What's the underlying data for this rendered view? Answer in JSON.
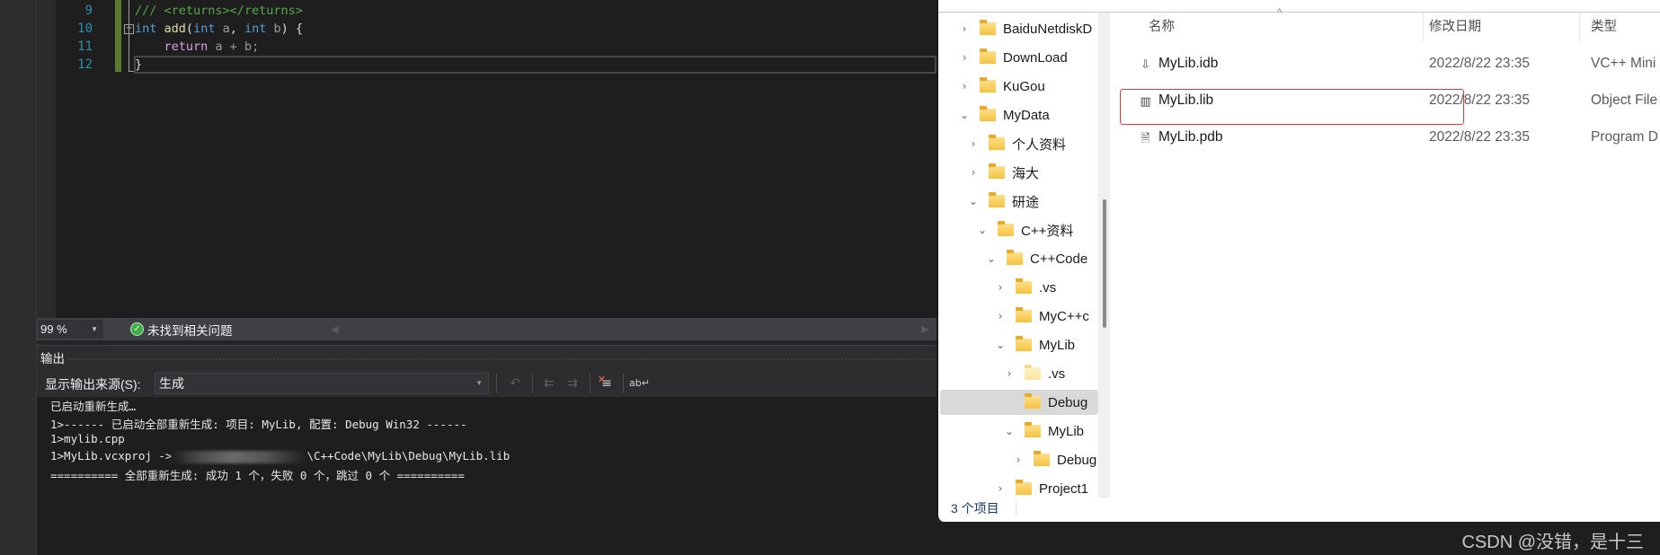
{
  "editor": {
    "line_numbers": [
      "9",
      "10",
      "11",
      "12"
    ],
    "lines": {
      "l9_comment": "/// <returns></returns>",
      "l10_kw1": "int",
      "l10_fn": "add",
      "l10_open": "(",
      "l10_kw2": "int",
      "l10_p1": " a",
      "l10_comma": ", ",
      "l10_kw3": "int",
      "l10_p2": " b",
      "l10_close": ") {",
      "l11_indent": "    ",
      "l11_kw": "return",
      "l11_expr": " a + b;",
      "l12": "}"
    },
    "fold_glyph": "−",
    "colors": {
      "keyword": "#569cd6",
      "function": "#dcdcaa",
      "comment": "#57a64a",
      "control": "#d8a0df",
      "line_number": "#2b91af"
    }
  },
  "status": {
    "zoom": "99 %",
    "issues_text": "未找到相关问题",
    "issues_icon": "check-circle-icon"
  },
  "output": {
    "title": "输出",
    "source_label": "显示输出来源(S):",
    "source_value": "生成",
    "toolbar": [
      "go-to-build-error-icon",
      "previous-message-icon",
      "next-message-icon",
      "clear-all-icon",
      "toggle-word-wrap-icon"
    ],
    "lines": [
      "已启动重新生成…",
      "1>------ 已启动全部重新生成: 项目: MyLib, 配置: Debug Win32 ------",
      "1>mylib.cpp",
      "1>MyLib.vcxproj ->",
      "\\C++Code\\MyLib\\Debug\\MyLib.lib",
      "========== 全部重新生成: 成功 1 个，失败 0 个，跳过 0 个 =========="
    ]
  },
  "explorer": {
    "tree": [
      {
        "label": "BaiduNetdiskD",
        "chevron": "›"
      },
      {
        "label": "DownLoad",
        "chevron": "›"
      },
      {
        "label": "KuGou",
        "chevron": "›"
      },
      {
        "label": "MyData",
        "chevron": "⌄"
      },
      {
        "label": "个人资料",
        "chevron": "›"
      },
      {
        "label": "海大",
        "chevron": "›"
      },
      {
        "label": "研途",
        "chevron": "⌄"
      },
      {
        "label": "C++资料",
        "chevron": "⌄"
      },
      {
        "label": "C++Code",
        "chevron": "⌄"
      },
      {
        "label": ".vs",
        "chevron": "›"
      },
      {
        "label": "MyC++c",
        "chevron": "›"
      },
      {
        "label": "MyLib",
        "chevron": "⌄"
      },
      {
        "label": ".vs",
        "chevron": "›"
      },
      {
        "label": "Debug",
        "chevron": ""
      },
      {
        "label": "MyLib",
        "chevron": "⌄"
      },
      {
        "label": "Debug",
        "chevron": "›"
      },
      {
        "label": "Project1",
        "chevron": "›"
      }
    ],
    "columns": {
      "name": "名称",
      "date": "修改日期",
      "type": "类型",
      "sort_glyph": "^"
    },
    "files": [
      {
        "name": "MyLib.idb",
        "date": "2022/8/22 23:35",
        "type": "VC++ Mini",
        "icon": "idb-file-icon",
        "glyph": "⇩"
      },
      {
        "name": "MyLib.lib",
        "date": "2022/8/22 23:35",
        "type": "Object File",
        "icon": "lib-file-icon",
        "glyph": "▥"
      },
      {
        "name": "MyLib.pdb",
        "date": "2022/8/22 23:35",
        "type": "Program D",
        "icon": "pdb-file-icon",
        "glyph": "🗎"
      }
    ],
    "item_count": "3 个项目",
    "highlight_color": "#e53935"
  },
  "watermark": "CSDN @没错，是十三"
}
